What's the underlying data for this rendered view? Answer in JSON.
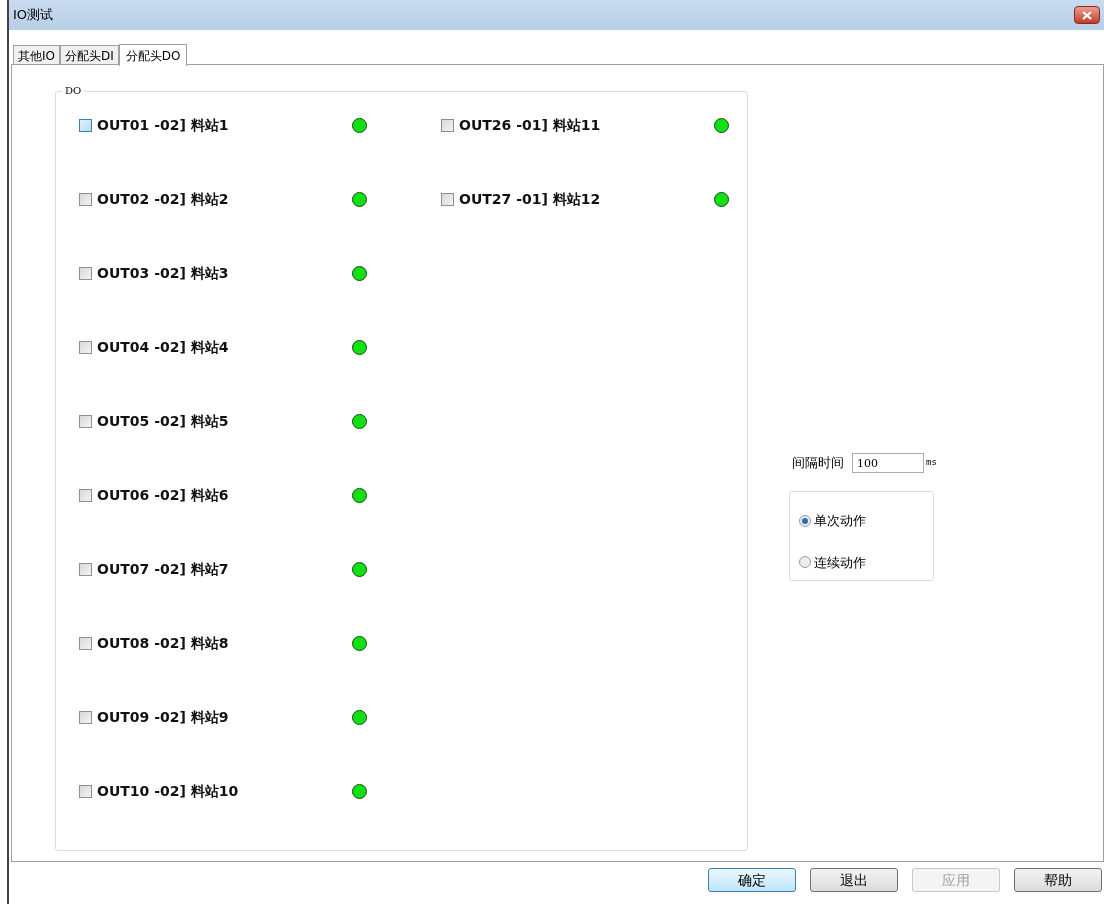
{
  "window": {
    "title": "IO测试"
  },
  "tabs": [
    {
      "label": "其他IO",
      "selected": false
    },
    {
      "label": "分配头DI",
      "selected": false
    },
    {
      "label": "分配头DO",
      "selected": true
    }
  ],
  "group": {
    "title": "DO"
  },
  "outputs": [
    [
      {
        "label": "OUT01 -02] 料站1",
        "checked": false,
        "hover": true,
        "on": true
      },
      {
        "label": "OUT02 -02] 料站2",
        "checked": false,
        "hover": false,
        "on": true
      },
      {
        "label": "OUT03 -02] 料站3",
        "checked": false,
        "hover": false,
        "on": true
      },
      {
        "label": "OUT04 -02] 料站4",
        "checked": false,
        "hover": false,
        "on": true
      },
      {
        "label": "OUT05 -02] 料站5",
        "checked": false,
        "hover": false,
        "on": true
      },
      {
        "label": "OUT06 -02] 料站6",
        "checked": false,
        "hover": false,
        "on": true
      },
      {
        "label": "OUT07 -02] 料站7",
        "checked": false,
        "hover": false,
        "on": true
      },
      {
        "label": "OUT08 -02] 料站8",
        "checked": false,
        "hover": false,
        "on": true
      },
      {
        "label": "OUT09 -02] 料站9",
        "checked": false,
        "hover": false,
        "on": true
      },
      {
        "label": "OUT10 -02] 料站10",
        "checked": false,
        "hover": false,
        "on": true
      }
    ],
    [
      {
        "label": "OUT26 -01] 料站11",
        "checked": false,
        "hover": false,
        "on": true
      },
      {
        "label": "OUT27 -01] 料站12",
        "checked": false,
        "hover": false,
        "on": true
      }
    ]
  ],
  "interval": {
    "label": "间隔时间",
    "value": "100",
    "unit": "ms"
  },
  "modes": [
    {
      "label": "单次动作",
      "selected": true
    },
    {
      "label": "连续动作",
      "selected": false
    }
  ],
  "buttons": [
    {
      "label": "确定",
      "default": true,
      "disabled": false
    },
    {
      "label": "退出",
      "default": false,
      "disabled": false
    },
    {
      "label": "应用",
      "default": false,
      "disabled": true
    },
    {
      "label": "帮助",
      "default": false,
      "disabled": false
    }
  ]
}
